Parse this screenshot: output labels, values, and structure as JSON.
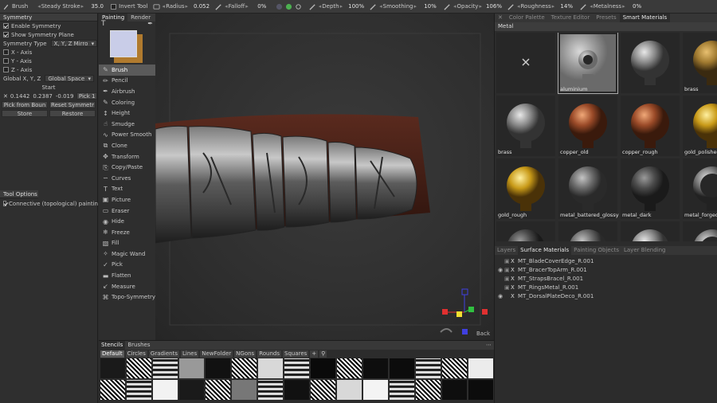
{
  "toolbar": {
    "brush_label": "Brush",
    "stroke_mode": "Steady Stroke",
    "stroke_value": "35.0",
    "invert_tool_label": "Invert Tool",
    "radius_label": "Radius",
    "radius_value": "0.052",
    "falloff_label": "Falloff",
    "falloff_value": "0%",
    "depth_label": "Depth",
    "depth_value": "100%",
    "smoothing_label": "Smoothing",
    "smoothing_value": "10%",
    "opacity_label": "Opacity",
    "opacity_value": "106%",
    "roughness_label": "Roughness",
    "roughness_value": "14%",
    "metalness_label": "Metalness",
    "metalness_value": "0%"
  },
  "symmetry": {
    "title": "Symmetry",
    "enable_label": "Enable Symmetry",
    "show_plane_label": "Show Symmetry Plane",
    "type_label": "Symmetry Type",
    "type_value": "X, Y, Z Mirro",
    "x_axis": "X - Axis",
    "y_axis": "Y - Axis",
    "z_axis": "Z - Axis",
    "global_label": "Global X, Y, Z",
    "space_value": "Global Space",
    "start_label": "Start",
    "coord_x": "0.1442",
    "coord_y": "0.2387",
    "coord_z": "-0.019",
    "pick_label": "Pick 1",
    "pick_from_bounds": "Pick from Boun",
    "reset_symmetry": "Reset Symmetr",
    "store": "Store",
    "restore": "Restore"
  },
  "tool_options": {
    "title": "Tool Options",
    "connective_label": "Connective (topological) paintin"
  },
  "tool_tabs": {
    "painting": "Painting",
    "render": "Render"
  },
  "tools": [
    {
      "label": "Brush",
      "icon": "brush-icon",
      "glyph": "✎"
    },
    {
      "label": "Pencil",
      "icon": "pencil-icon",
      "glyph": "✏"
    },
    {
      "label": "Airbrush",
      "icon": "airbrush-icon",
      "glyph": "✒"
    },
    {
      "label": "Coloring",
      "icon": "coloring-icon",
      "glyph": "✎"
    },
    {
      "label": "Height",
      "icon": "height-icon",
      "glyph": "↕"
    },
    {
      "label": "Smudge",
      "icon": "smudge-icon",
      "glyph": "☝"
    },
    {
      "label": "Power Smooth",
      "icon": "power-smooth-icon",
      "glyph": "∿"
    },
    {
      "label": "Clone",
      "icon": "clone-icon",
      "glyph": "⧉"
    },
    {
      "label": "Transform",
      "icon": "transform-icon",
      "glyph": "✥"
    },
    {
      "label": "Copy/Paste",
      "icon": "copy-paste-icon",
      "glyph": "⎘"
    },
    {
      "label": "Curves",
      "icon": "curves-icon",
      "glyph": "∽"
    },
    {
      "label": "Text",
      "icon": "text-icon",
      "glyph": "T"
    },
    {
      "label": "Picture",
      "icon": "picture-icon",
      "glyph": "▣"
    },
    {
      "label": "Eraser",
      "icon": "eraser-icon",
      "glyph": "▭"
    },
    {
      "label": "Hide",
      "icon": "hide-icon",
      "glyph": "◉"
    },
    {
      "label": "Freeze",
      "icon": "freeze-icon",
      "glyph": "❄"
    },
    {
      "label": "Fill",
      "icon": "fill-icon",
      "glyph": "▧"
    },
    {
      "label": "Magic Wand",
      "icon": "magic-wand-icon",
      "glyph": "✧"
    },
    {
      "label": "Pick",
      "icon": "pick-icon",
      "glyph": "✓"
    },
    {
      "label": "Flatten",
      "icon": "flatten-icon",
      "glyph": "▬"
    },
    {
      "label": "Measure",
      "icon": "measure-icon",
      "glyph": "↙"
    },
    {
      "label": "Topo-Symmetry",
      "icon": "topo-symmetry-icon",
      "glyph": "⌘"
    }
  ],
  "viewport": {
    "back_label": "Back"
  },
  "stencils": {
    "tabs": [
      "Stencils",
      "Brushes"
    ],
    "categories": [
      "Default",
      "Circles",
      "Gradients",
      "Lines",
      "NewFolder",
      "NGons",
      "Rounds",
      "Squares"
    ]
  },
  "right_tabs": [
    "Color Palette",
    "Texture Editor",
    "Presets",
    "Smart Materials"
  ],
  "materials": {
    "folder": "Metal",
    "items": [
      {
        "label": "",
        "kind": "none"
      },
      {
        "label": "aluminium",
        "kind": "plate"
      },
      {
        "label": "",
        "kind": "silver"
      },
      {
        "label": "brass",
        "kind": "brass"
      },
      {
        "label": "brass",
        "kind": "silver"
      },
      {
        "label": "copper_old",
        "kind": "copper"
      },
      {
        "label": "copper_rough",
        "kind": "copper"
      },
      {
        "label": "gold_polished",
        "kind": "gold"
      },
      {
        "label": "gold_rough",
        "kind": "gold"
      },
      {
        "label": "metal_battered_glossy",
        "kind": "gray"
      },
      {
        "label": "metal_dark",
        "kind": "dark"
      },
      {
        "label": "metal_forged",
        "kind": "ring"
      },
      {
        "label": "",
        "kind": "dark"
      },
      {
        "label": "",
        "kind": "gray"
      },
      {
        "label": "",
        "kind": "silver"
      },
      {
        "label": "",
        "kind": "ring"
      }
    ]
  },
  "layer_tabs": [
    "Layers",
    "Surface Materials",
    "Painting Objects",
    "Layer Blending"
  ],
  "layers": [
    {
      "name": "MT_BladeCoverEdge_R.001"
    },
    {
      "name": "MT_BracerTopArm_R.001"
    },
    {
      "name": "MT_StrapsBracel_R.001"
    },
    {
      "name": "MT_RingsMetal_R.001"
    },
    {
      "name": "MT_DorsalPlateDeco_R.001"
    }
  ],
  "colors": {
    "accent_yellow": "#f5c530",
    "primary_swatch": "#c9cde8",
    "secondary_swatch": "#b07a2e",
    "gizmo_x": "#e03030",
    "gizmo_y": "#30c040",
    "gizmo_z": "#4040e0"
  }
}
